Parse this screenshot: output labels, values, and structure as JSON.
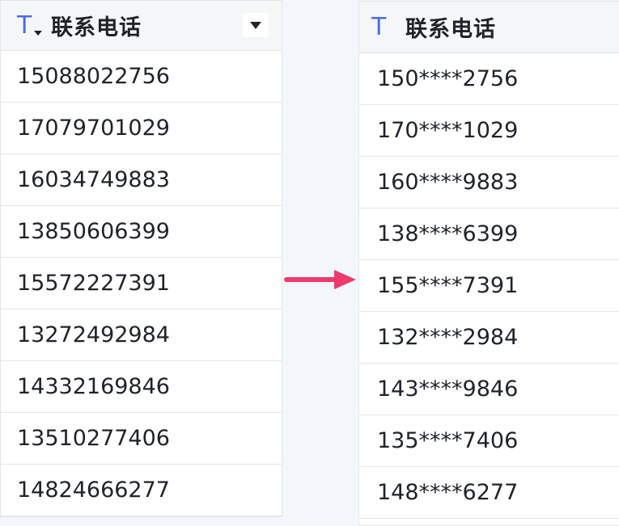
{
  "left_column": {
    "header_icon": "text-type-icon",
    "title": "联系电话",
    "dropdown_icon": "caret-down-icon",
    "rows": [
      "15088022756",
      "17079701029",
      "16034749883",
      "13850606399",
      "15572227391",
      "13272492984",
      "14332169846",
      "13510277406",
      "14824666277"
    ]
  },
  "arrow_icon": "right-arrow-icon",
  "right_column": {
    "header_icon": "text-type-icon",
    "title": "联系电话",
    "rows": [
      "150****2756",
      "170****1029",
      "160****9883",
      "138****6399",
      "155****7391",
      "132****2984",
      "143****9846",
      "135****7406",
      "148****6277"
    ]
  },
  "colors": {
    "accent_blue": "#4a6ee0",
    "arrow_pink": "#ec3b6a",
    "header_bg": "#f5f6f7",
    "border": "#e3e5e8",
    "text": "#1f2329"
  }
}
